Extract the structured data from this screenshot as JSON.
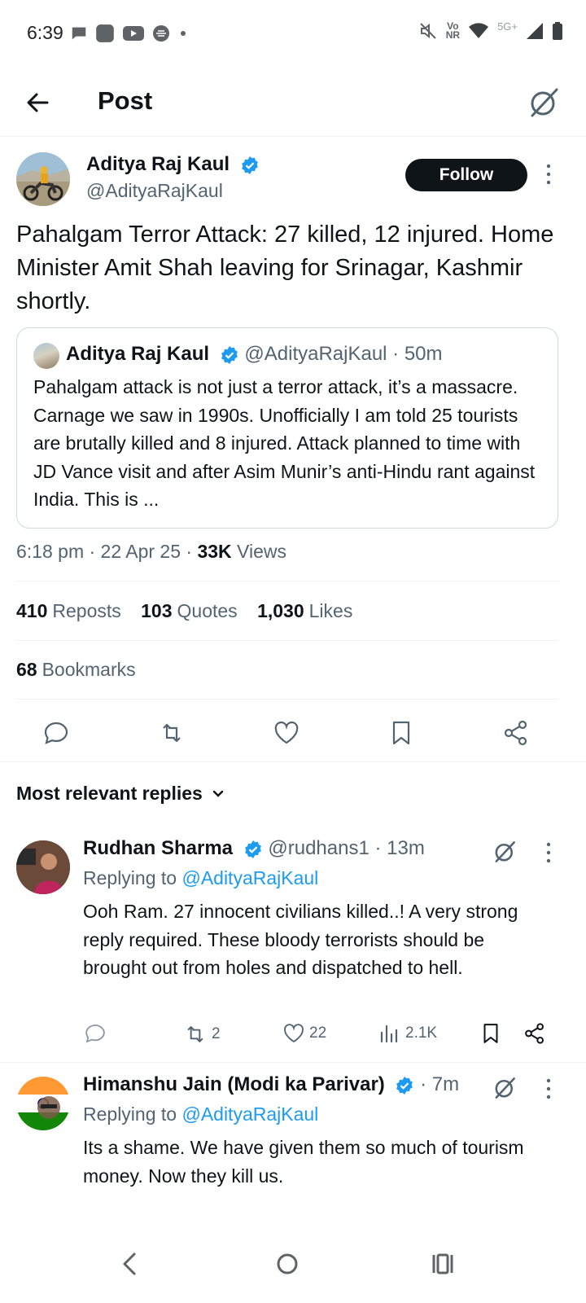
{
  "status_bar": {
    "time": "6:39",
    "network_vo": "Vo",
    "network_nr": "NR",
    "network_5g": "5G+",
    "icons": [
      "chat-bubble-icon",
      "app-square-icon",
      "youtube-icon",
      "pizza-icon",
      "dot-icon",
      "mute-icon",
      "wifi-icon",
      "signal-icon",
      "battery-icon"
    ]
  },
  "header": {
    "title": "Post"
  },
  "post": {
    "author_name": "Aditya Raj Kaul",
    "author_handle": "@AdityaRajKaul",
    "follow_label": "Follow",
    "text": "Pahalgam Terror Attack: 27 killed, 12 injured. Home Minister Amit Shah leaving for Srinagar, Kashmir shortly.",
    "quote": {
      "author_name": "Aditya Raj Kaul",
      "handle_time": "@AdityaRajKaul · 50m",
      "text": "Pahalgam attack is not just a terror attack, it’s a massacre. Carnage we saw in 1990s. Unofficially I am told 25 tourists are brutally killed and 8 injured. Attack planned to time with JD Vance visit and after Asim Munir’s anti-Hindu rant against India. This is ..."
    },
    "meta_prefix": "6:18 pm · 22 Apr 25 · ",
    "views_count": "33K",
    "views_label": " Views",
    "stats": {
      "reposts_count": "410",
      "reposts_label": "Reposts",
      "quotes_count": "103",
      "quotes_label": "Quotes",
      "likes_count": "1,030",
      "likes_label": "Likes",
      "bookmarks_count": "68",
      "bookmarks_label": "Bookmarks"
    }
  },
  "replies_header": "Most relevant replies",
  "replies": [
    {
      "name": "Rudhan Sharma",
      "handle_time": "@rudhans1 · 13m",
      "replying_prefix": "Replying to ",
      "replying_to": "@AdityaRajKaul",
      "text": "Ooh Ram. 27 innocent civilians killed..! A very strong reply required. These bloody terrorists should be brought out from holes and dispatched to hell.",
      "reposts": "2",
      "likes": "22",
      "views": "2.1K"
    },
    {
      "name": "Himanshu Jain (Modi ka Parivar)",
      "handle_time": "· 7m",
      "replying_prefix": "Replying to ",
      "replying_to": "@AdityaRajKaul",
      "text": "Its a shame. We have given them so much of tourism money. Now they kill us."
    }
  ],
  "colors": {
    "text": "#0f1419",
    "secondary": "#536471",
    "link": "#1d9bf0",
    "verified": "#1d9bf0",
    "border": "#cfd9de"
  }
}
